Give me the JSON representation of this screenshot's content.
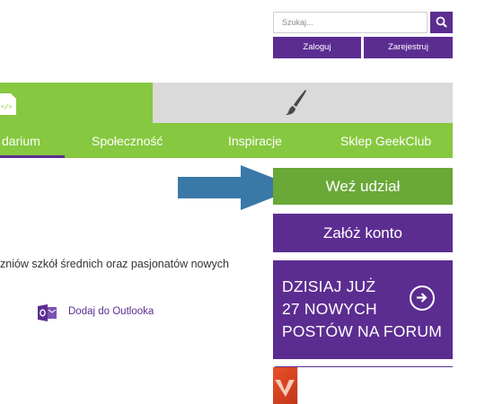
{
  "search": {
    "placeholder": "Szukaj..."
  },
  "auth": {
    "login_label": "Zaloguj",
    "register_label": "Zarejestruj"
  },
  "nav": {
    "items": [
      {
        "label": "darium"
      },
      {
        "label": "Społeczność"
      },
      {
        "label": "Inspiracje"
      },
      {
        "label": "Sklep GeekClub"
      }
    ]
  },
  "sidebar": {
    "join_label": "Weź udział",
    "account_label": "Załóż konto",
    "forum_lines": [
      "DZISIAJ JUŻ",
      "27 NOWYCH",
      "POSTÓW NA FORUM"
    ]
  },
  "content": {
    "description": "zniów szkół średnich oraz pasjonatów nowych",
    "outlook_link": "Dodaj do Outlooka"
  },
  "colors": {
    "purple": "#5c2d91",
    "green": "#86c83f",
    "dark_green": "#6aa837",
    "arrow_blue": "#3a78a8"
  },
  "icons": [
    "search-icon",
    "code-file-icon",
    "paintbrush-icon",
    "arrow-right-icon",
    "circle-arrow-right-icon",
    "outlook-icon",
    "office-icon"
  ]
}
